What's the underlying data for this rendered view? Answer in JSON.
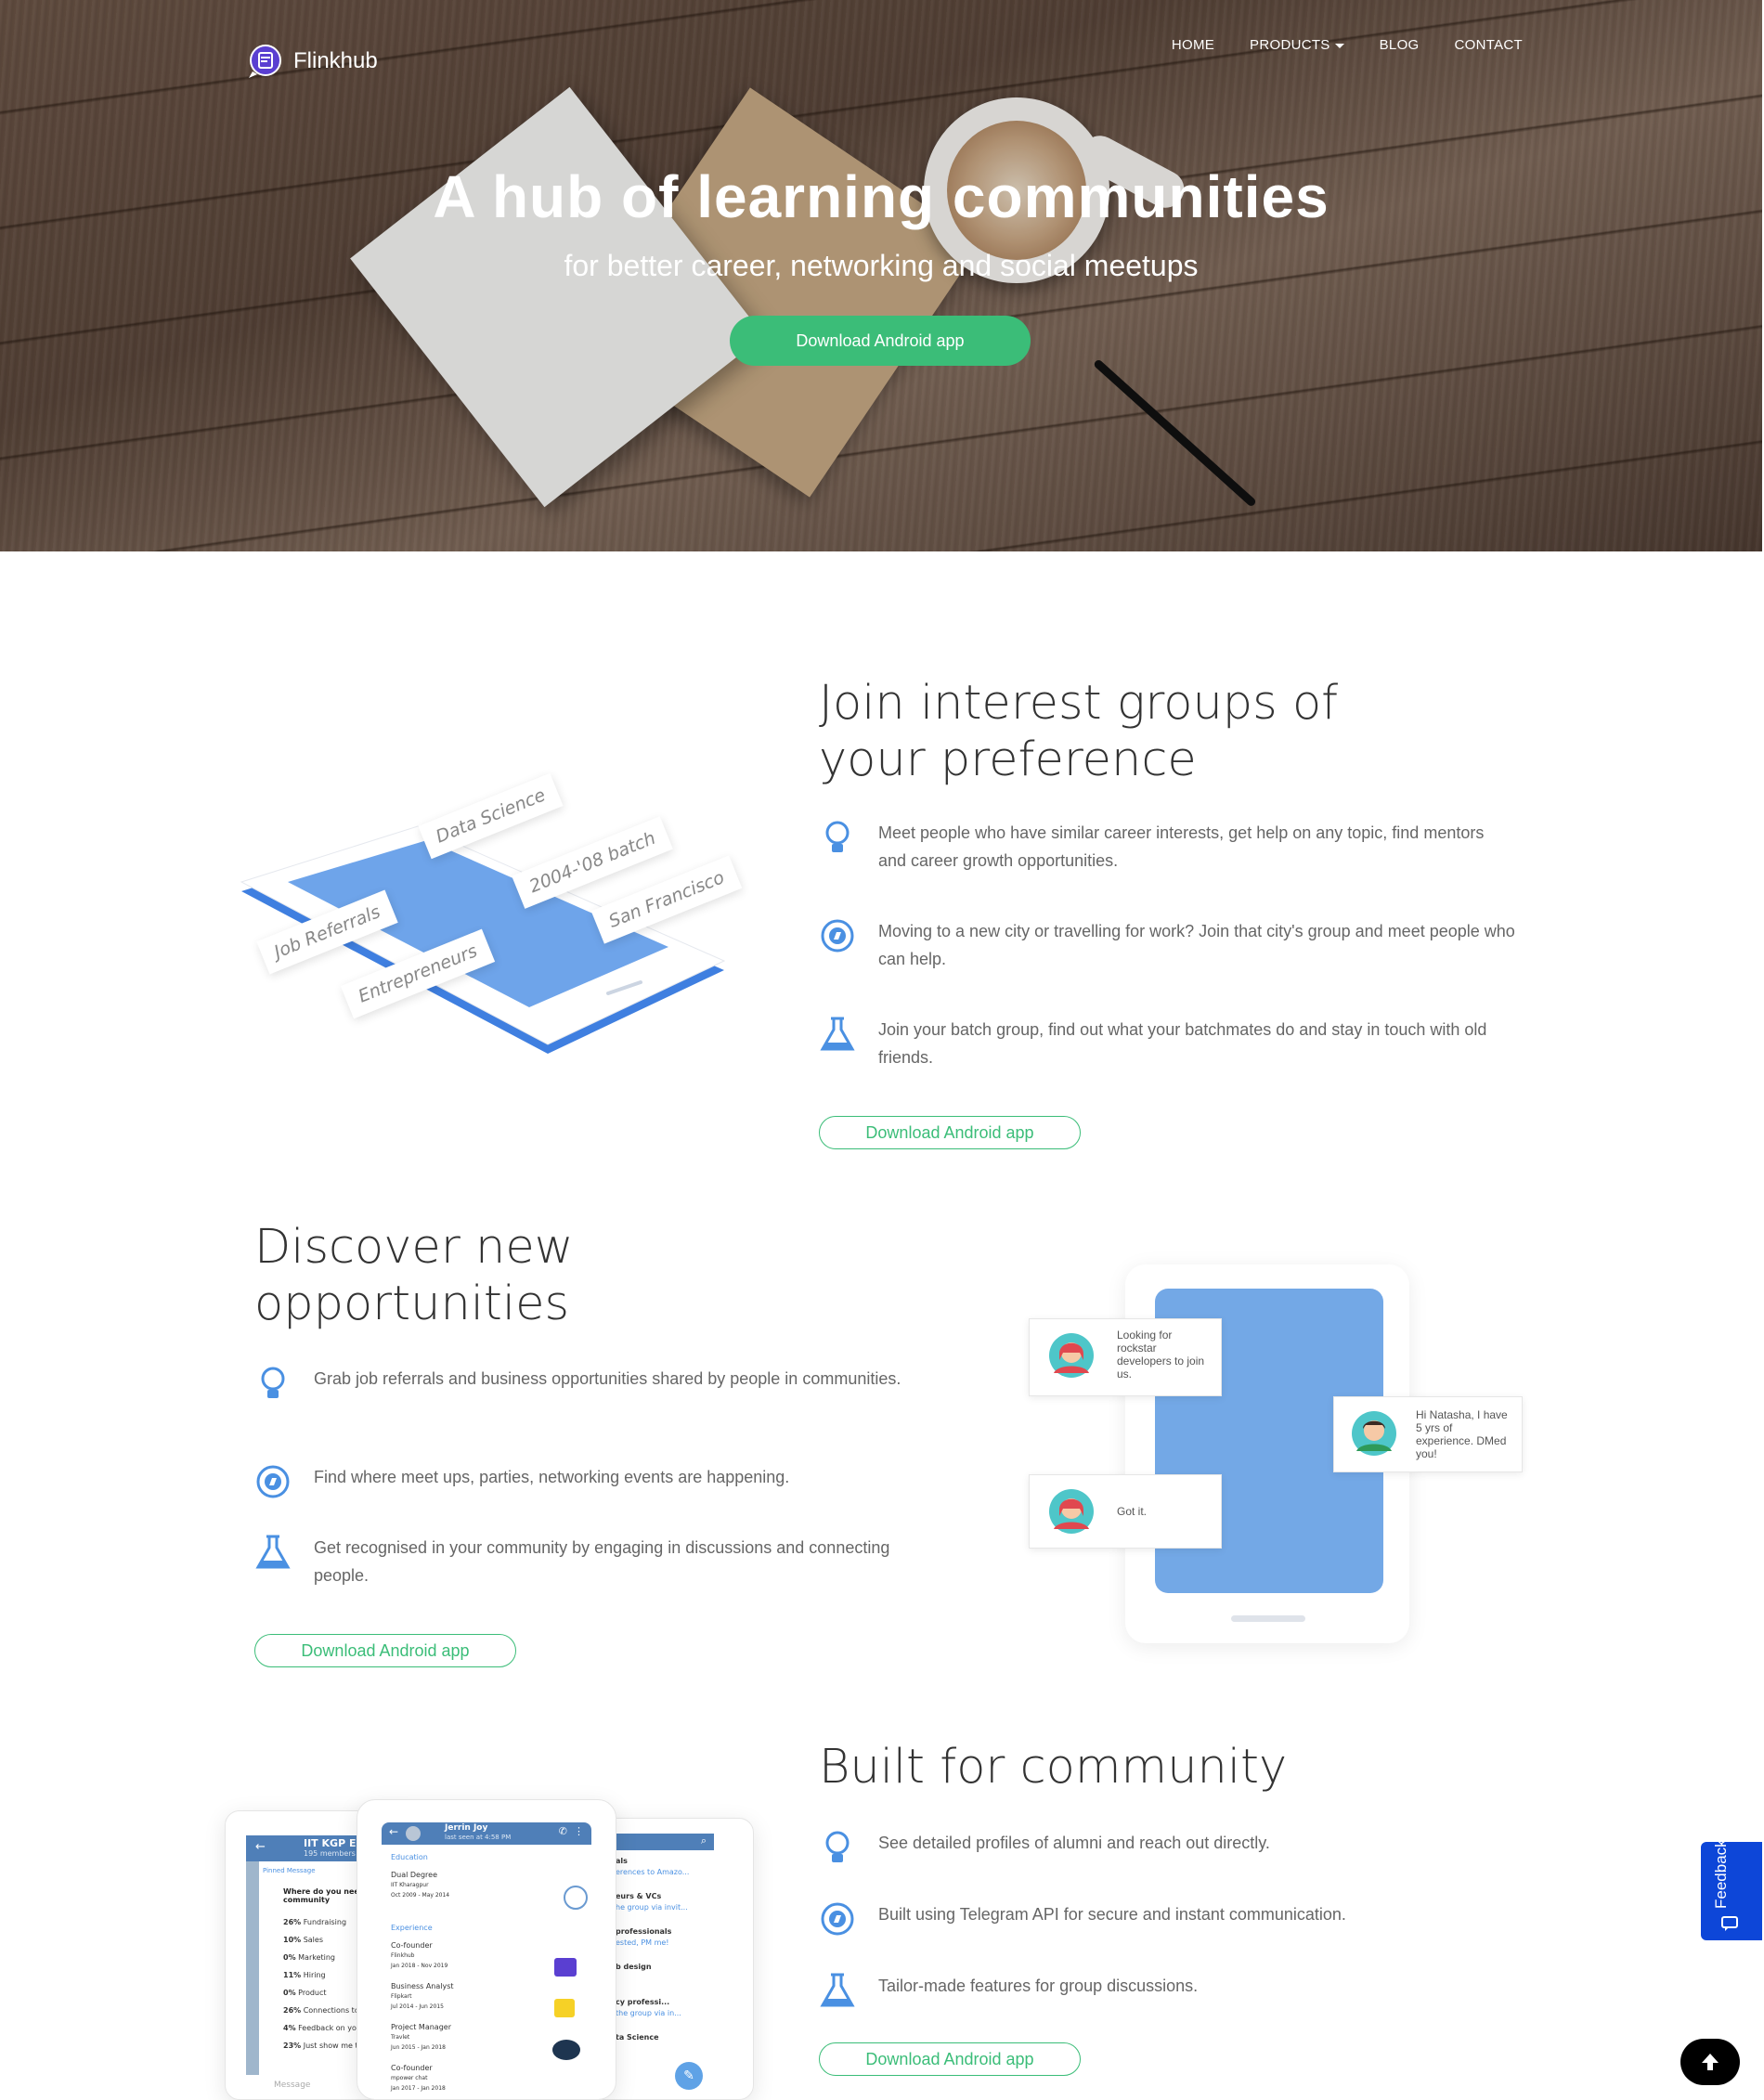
{
  "brand": {
    "name": "Flinkhub"
  },
  "nav": {
    "home": "HOME",
    "products": "PRODUCTS",
    "blog": "BLOG",
    "contact": "CONTACT"
  },
  "hero": {
    "title": "A hub of learning communities",
    "subtitle": "for better career, networking and social meetups",
    "cta": "Download Android app"
  },
  "section1": {
    "title_line1": "Join interest groups of",
    "title_line2": "your preference",
    "tags": [
      "Data Science",
      "2004-'08 batch",
      "San Francisco",
      "Job Referrals",
      "Entrepreneurs"
    ],
    "features": [
      {
        "icon": "lightbulb-icon",
        "text": "Meet people who have similar career interests, get help on any topic, find mentors and career growth opportunities."
      },
      {
        "icon": "compass-icon",
        "text": "Moving to a new city or travelling for work? Join that city's group and meet people who can help."
      },
      {
        "icon": "flask-icon",
        "text": "Join your batch group, find out what your batchmates do and stay in touch with old friends."
      }
    ],
    "cta": "Download Android app"
  },
  "section2": {
    "title_line1": "Discover new",
    "title_line2": "opportunities",
    "features": [
      {
        "icon": "lightbulb-icon",
        "text": "Grab job referrals and business opportunities shared by people in communities."
      },
      {
        "icon": "compass-icon",
        "text": "Find where meet ups, parties, networking events are happening."
      },
      {
        "icon": "flask-icon",
        "text": "Get recognised in your community by engaging in discussions and connecting people."
      }
    ],
    "cta": "Download Android app",
    "chat": {
      "msg1": "Looking for rockstar developers to join us.",
      "msg2": "Hi Natasha, I have 5 yrs of experience. DMed you!",
      "msg3": "Got it."
    }
  },
  "section3": {
    "title": "Built for community",
    "features": [
      {
        "icon": "lightbulb-icon",
        "text": "See detailed profiles of alumni and reach out directly."
      },
      {
        "icon": "compass-icon",
        "text": "Built using Telegram API for secure and instant communication."
      },
      {
        "icon": "flask-icon",
        "text": "Tailor-made features for group discussions."
      }
    ],
    "cta": "Download Android app",
    "screens": {
      "left_title": "IIT KGP Ent...",
      "left_sub": "195 members",
      "left_pinned": "Pinned Message",
      "left_question": "Where do you need the kgp community",
      "left_rows": [
        {
          "pct": "26%",
          "label": "Fundraising"
        },
        {
          "pct": "10%",
          "label": "Sales"
        },
        {
          "pct": "0%",
          "label": "Marketing"
        },
        {
          "pct": "11%",
          "label": "Hiring"
        },
        {
          "pct": "0%",
          "label": "Product"
        },
        {
          "pct": "26%",
          "label": "Connections to experts"
        },
        {
          "pct": "4%",
          "label": "Feedback on yo..."
        },
        {
          "pct": "23%",
          "label": "Just show me t..."
        }
      ],
      "left_message": "Message",
      "mid_name": "Jerrin Joy",
      "mid_status": "last seen at 4:58 PM",
      "mid_education": "Education",
      "mid_edu_title": "Dual Degree",
      "mid_edu_org": "IIT Kharagpur",
      "mid_edu_dates": "Oct 2009 - May 2014",
      "mid_experience": "Experience",
      "mid_jobs": [
        {
          "title": "Co-founder",
          "org": "Flinkhub",
          "dates": "Jan 2018 - Nov 2019"
        },
        {
          "title": "Business Analyst",
          "org": "Flipkart",
          "dates": "Jul 2014 - Jun 2015"
        },
        {
          "title": "Project Manager",
          "org": "Travlet",
          "dates": "Jun 2015 - Jan 2018"
        },
        {
          "title": "Co-founder",
          "org": "mpower chat",
          "dates": "Jan 2017 - Jan 2018"
        }
      ],
      "right_rows": [
        {
          "a": "als",
          "b": "erences to Amazo..."
        },
        {
          "a": "eurs & VCs",
          "b": "he group via invit..."
        },
        {
          "a": "professionals",
          "b": "ested, PM me!"
        },
        {
          "a": "b design",
          "b": ""
        },
        {
          "a": "cy professi...",
          "b": "the group via in..."
        },
        {
          "a": "ta Science",
          "b": ""
        }
      ]
    }
  },
  "widgets": {
    "feedback": "Feedback"
  },
  "colors": {
    "accent_green": "#3bbd78",
    "icon_blue": "#4a90e2",
    "feedback_blue": "#0d46d8"
  }
}
